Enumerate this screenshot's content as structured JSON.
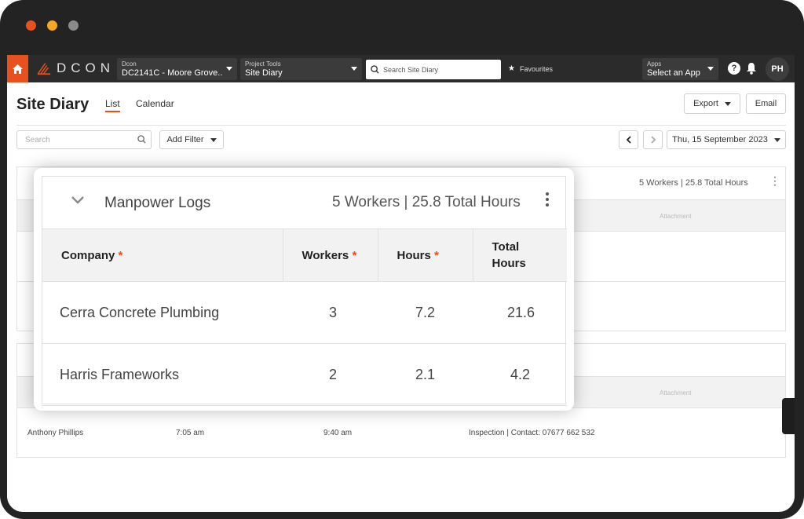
{
  "appbar": {
    "logo_text": "DCON",
    "company_selector": {
      "small": "Dcon",
      "value": "DC2141C - Moore Grove..."
    },
    "tools_selector": {
      "small": "Project Tools",
      "value": "Site Diary"
    },
    "search_placeholder": "Search Site Diary",
    "favourites_label": "Favourites",
    "apps_selector": {
      "small": "Apps",
      "value": "Select an App"
    },
    "help_glyph": "?",
    "avatar_initials": "PH"
  },
  "header": {
    "title": "Site Diary",
    "tabs": [
      {
        "label": "List"
      },
      {
        "label": "Calendar"
      }
    ],
    "export_label": "Export",
    "email_label": "Email"
  },
  "filters": {
    "search_placeholder": "Search",
    "add_filter_label": "Add Filter",
    "date_label": "Thu, 15 September 2023"
  },
  "background": {
    "card1_summary": "5 Workers | 25.8 Total Hours",
    "attachment_label": "Attachment",
    "visitor_row": {
      "name": "Anthony Phillips",
      "time_in": "7:05 am",
      "time_out": "9:40 am",
      "purpose": "Inspection | Contact: 07677 662 532"
    }
  },
  "manpower": {
    "title": "Manpower Logs",
    "summary": "5 Workers | 25.8 Total Hours",
    "columns": [
      {
        "label": "Company",
        "required": "*"
      },
      {
        "label": "Workers",
        "required": "*"
      },
      {
        "label": "Hours",
        "required": "*"
      },
      {
        "label": "Total Hours",
        "required": ""
      }
    ],
    "rows": [
      {
        "company": "Cerra Concrete Plumbing",
        "workers": "3",
        "hours": "7.2",
        "total": "21.6"
      },
      {
        "company": "Harris Frameworks",
        "workers": "2",
        "hours": "2.1",
        "total": "4.2"
      }
    ]
  },
  "colors": {
    "accent": "#e8501e",
    "appbar": "#2b2b2b",
    "frame": "#232323"
  },
  "icons": [
    "home-icon",
    "search-icon",
    "star-icon",
    "help-icon",
    "bell-icon",
    "chevron-down-icon",
    "chevron-left-icon",
    "chevron-right-icon",
    "kebab-icon"
  ]
}
